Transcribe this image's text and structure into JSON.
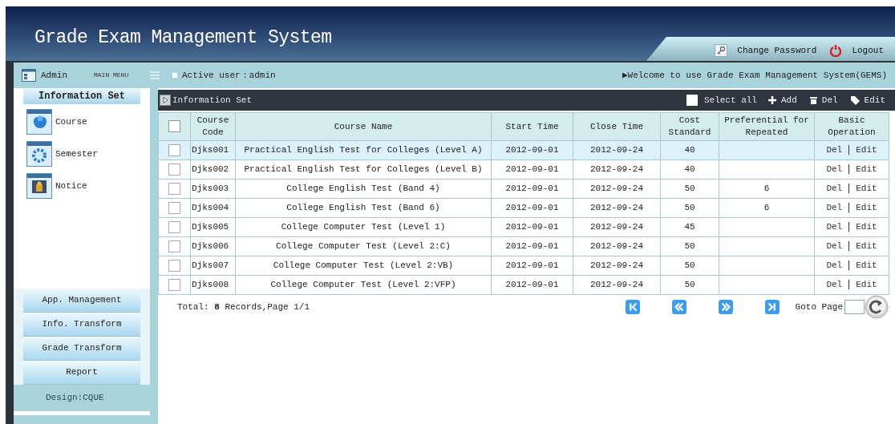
{
  "header": {
    "title": "Grade Exam Management System",
    "links": [
      {
        "label": "Change Password",
        "kind": "key"
      },
      {
        "label": "Logout",
        "kind": "power"
      }
    ]
  },
  "topbar": {
    "admin": "Admin",
    "main_menu": "MAIN MENU",
    "active_user": "Active user：admin",
    "welcome": "▶Welcome to use Grade Exam Management System(GEMS)"
  },
  "sidebar": {
    "section_title": "Information Set",
    "items": [
      {
        "label": "Course",
        "kind": "course"
      },
      {
        "label": "Semester",
        "kind": "semester"
      },
      {
        "label": "Notice",
        "kind": "notice"
      }
    ],
    "nav_buttons": [
      "App. Management",
      "Info. Transform",
      "Grade Transform",
      "Report"
    ],
    "footer": "Design:CQUE"
  },
  "panel": {
    "title": "Information Set",
    "select_all": {
      "label": "Select all",
      "checked": false
    },
    "actions": [
      {
        "label": "Add",
        "kind": "add"
      },
      {
        "label": "Del",
        "kind": "del"
      },
      {
        "label": "Edit",
        "kind": "edit"
      }
    ]
  },
  "table": {
    "header_checked": false,
    "columns": [
      "Course Code",
      "Course Name",
      "Start Time",
      "Close Time",
      "Cost Standard",
      "Preferential for Repeated",
      "Basic Operation"
    ],
    "rows": [
      {
        "selected": true,
        "checked": false,
        "cells": [
          "Djks001",
          "Practical English Test for Colleges (Level A)",
          "2012-09-01",
          "2012-09-24",
          "40",
          ""
        ],
        "operations": [
          "Del",
          "Edit"
        ]
      },
      {
        "selected": false,
        "checked": false,
        "cells": [
          "Djks002",
          "Practical English Test for Colleges (Level B)",
          "2012-09-01",
          "2012-09-24",
          "40",
          ""
        ],
        "operations": [
          "Del",
          "Edit"
        ]
      },
      {
        "selected": false,
        "checked": false,
        "cells": [
          "Djks003",
          "College English Test (Band 4)",
          "2012-09-01",
          "2012-09-24",
          "50",
          "6"
        ],
        "operations": [
          "Del",
          "Edit"
        ]
      },
      {
        "selected": false,
        "checked": false,
        "cells": [
          "Djks004",
          "College English Test (Band 6)",
          "2012-09-01",
          "2012-09-24",
          "50",
          "6"
        ],
        "operations": [
          "Del",
          "Edit"
        ]
      },
      {
        "selected": false,
        "checked": false,
        "cells": [
          "Djks005",
          "College Computer Test (Level 1)",
          "2012-09-01",
          "2012-09-24",
          "45",
          ""
        ],
        "operations": [
          "Del",
          "Edit"
        ]
      },
      {
        "selected": false,
        "checked": false,
        "cells": [
          "Djks006",
          "College Computer Test (Level 2:C)",
          "2012-09-01",
          "2012-09-24",
          "50",
          ""
        ],
        "operations": [
          "Del",
          "Edit"
        ]
      },
      {
        "selected": false,
        "checked": false,
        "cells": [
          "Djks007",
          "College Computer Test (Level 2:VB)",
          "2012-09-01",
          "2012-09-24",
          "50",
          ""
        ],
        "operations": [
          "Del",
          "Edit"
        ]
      },
      {
        "selected": false,
        "checked": false,
        "cells": [
          "Djks008",
          "College Computer Test (Level 2:VFP)",
          "2012-09-01",
          "2012-09-24",
          "50",
          ""
        ],
        "operations": [
          "Del",
          "Edit"
        ]
      }
    ]
  },
  "pager": {
    "summary": "Total: **8** Records,Page 1/1",
    "buttons": [
      {
        "kind": "first"
      },
      {
        "kind": "prev"
      },
      {
        "kind": "next"
      },
      {
        "kind": "last"
      }
    ],
    "goto_label": "Goto Page"
  }
}
